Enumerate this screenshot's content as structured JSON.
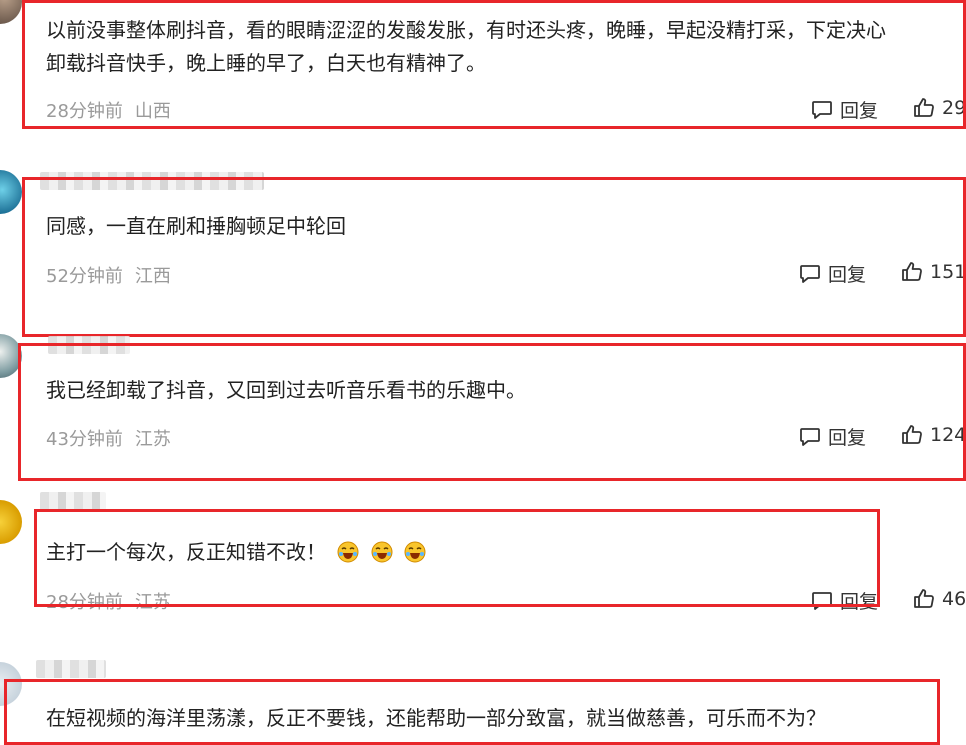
{
  "comments": [
    {
      "text_line1": "以前没事整体刷抖音，看的眼睛涩涩的发酸发胀，有时还头疼，晚睡，早起没精打采，下定决心",
      "text_line2": "卸载抖音快手，晚上睡的早了，白天也有精神了。",
      "time": "28分钟前",
      "region": "山西",
      "reply_label": "回复",
      "likes": "29"
    },
    {
      "text_line1": "同感，一直在刷和捶胸顿足中轮回",
      "time": "52分钟前",
      "region": "江西",
      "reply_label": "回复",
      "likes": "151"
    },
    {
      "text_line1": "我已经卸载了抖音，又回到过去听音乐看书的乐趣中。",
      "time": "43分钟前",
      "region": "江苏",
      "reply_label": "回复",
      "likes": "124"
    },
    {
      "text_line1": "主打一个每次，反正知错不改！",
      "emoji_count": 3,
      "time": "28分钟前",
      "region": "江苏",
      "reply_label": "回复",
      "likes": "46"
    },
    {
      "text_line1": "在短视频的海洋里荡漾，反正不要钱，还能帮助一部分致富，就当做慈善，可乐而不为？"
    }
  ],
  "colors": {
    "highlight_border": "#e8262a",
    "meta_text": "#9a9a9a",
    "body_text": "#222222"
  },
  "icons": {
    "reply": "comment-bubble-icon",
    "like": "thumbs-up-icon",
    "emoji": "crying-laughing-emoji-icon"
  }
}
